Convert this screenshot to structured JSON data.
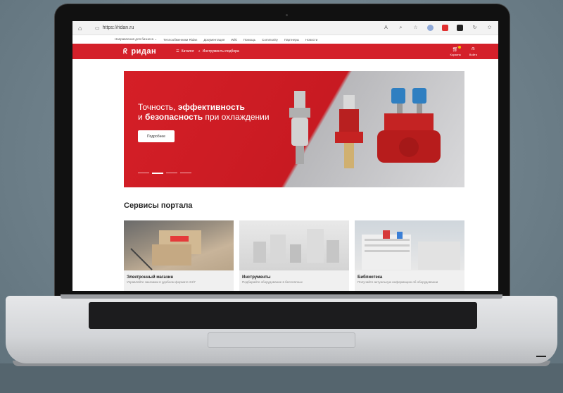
{
  "browser": {
    "url": "https://ridan.ru",
    "lock_icon": "site-info-icon"
  },
  "topnav": {
    "items": [
      "Направления для бизнеса ⌄",
      "Теплообменники Ridan",
      "Документация",
      "Wiki",
      "Помощь",
      "Community",
      "Партнеры",
      "Новости"
    ]
  },
  "header": {
    "logo": "ридан",
    "catalog": "Каталог",
    "tools": "Инструменты подбора",
    "cart": "Корзина",
    "login": "Войти",
    "brand_color": "#d4202a"
  },
  "hero": {
    "line1_prefix": "Точность, ",
    "line1_bold": "эффективность",
    "line2_prefix": "и ",
    "line2_bold": "безопасность",
    "line2_suffix": " при охлаждении",
    "button": "Подробнее",
    "slides": 4,
    "active_slide": 2
  },
  "services": {
    "title": "Сервисы портала",
    "cards": [
      {
        "title": "Электронный магазин",
        "subtitle": "Управляйте заказами в удобном формате 24/7"
      },
      {
        "title": "Инструменты",
        "subtitle": "Подбирайте оборудование в бесплатных"
      },
      {
        "title": "Библиотека",
        "subtitle": "Получайте актуальную информацию об оборудовании"
      }
    ]
  }
}
